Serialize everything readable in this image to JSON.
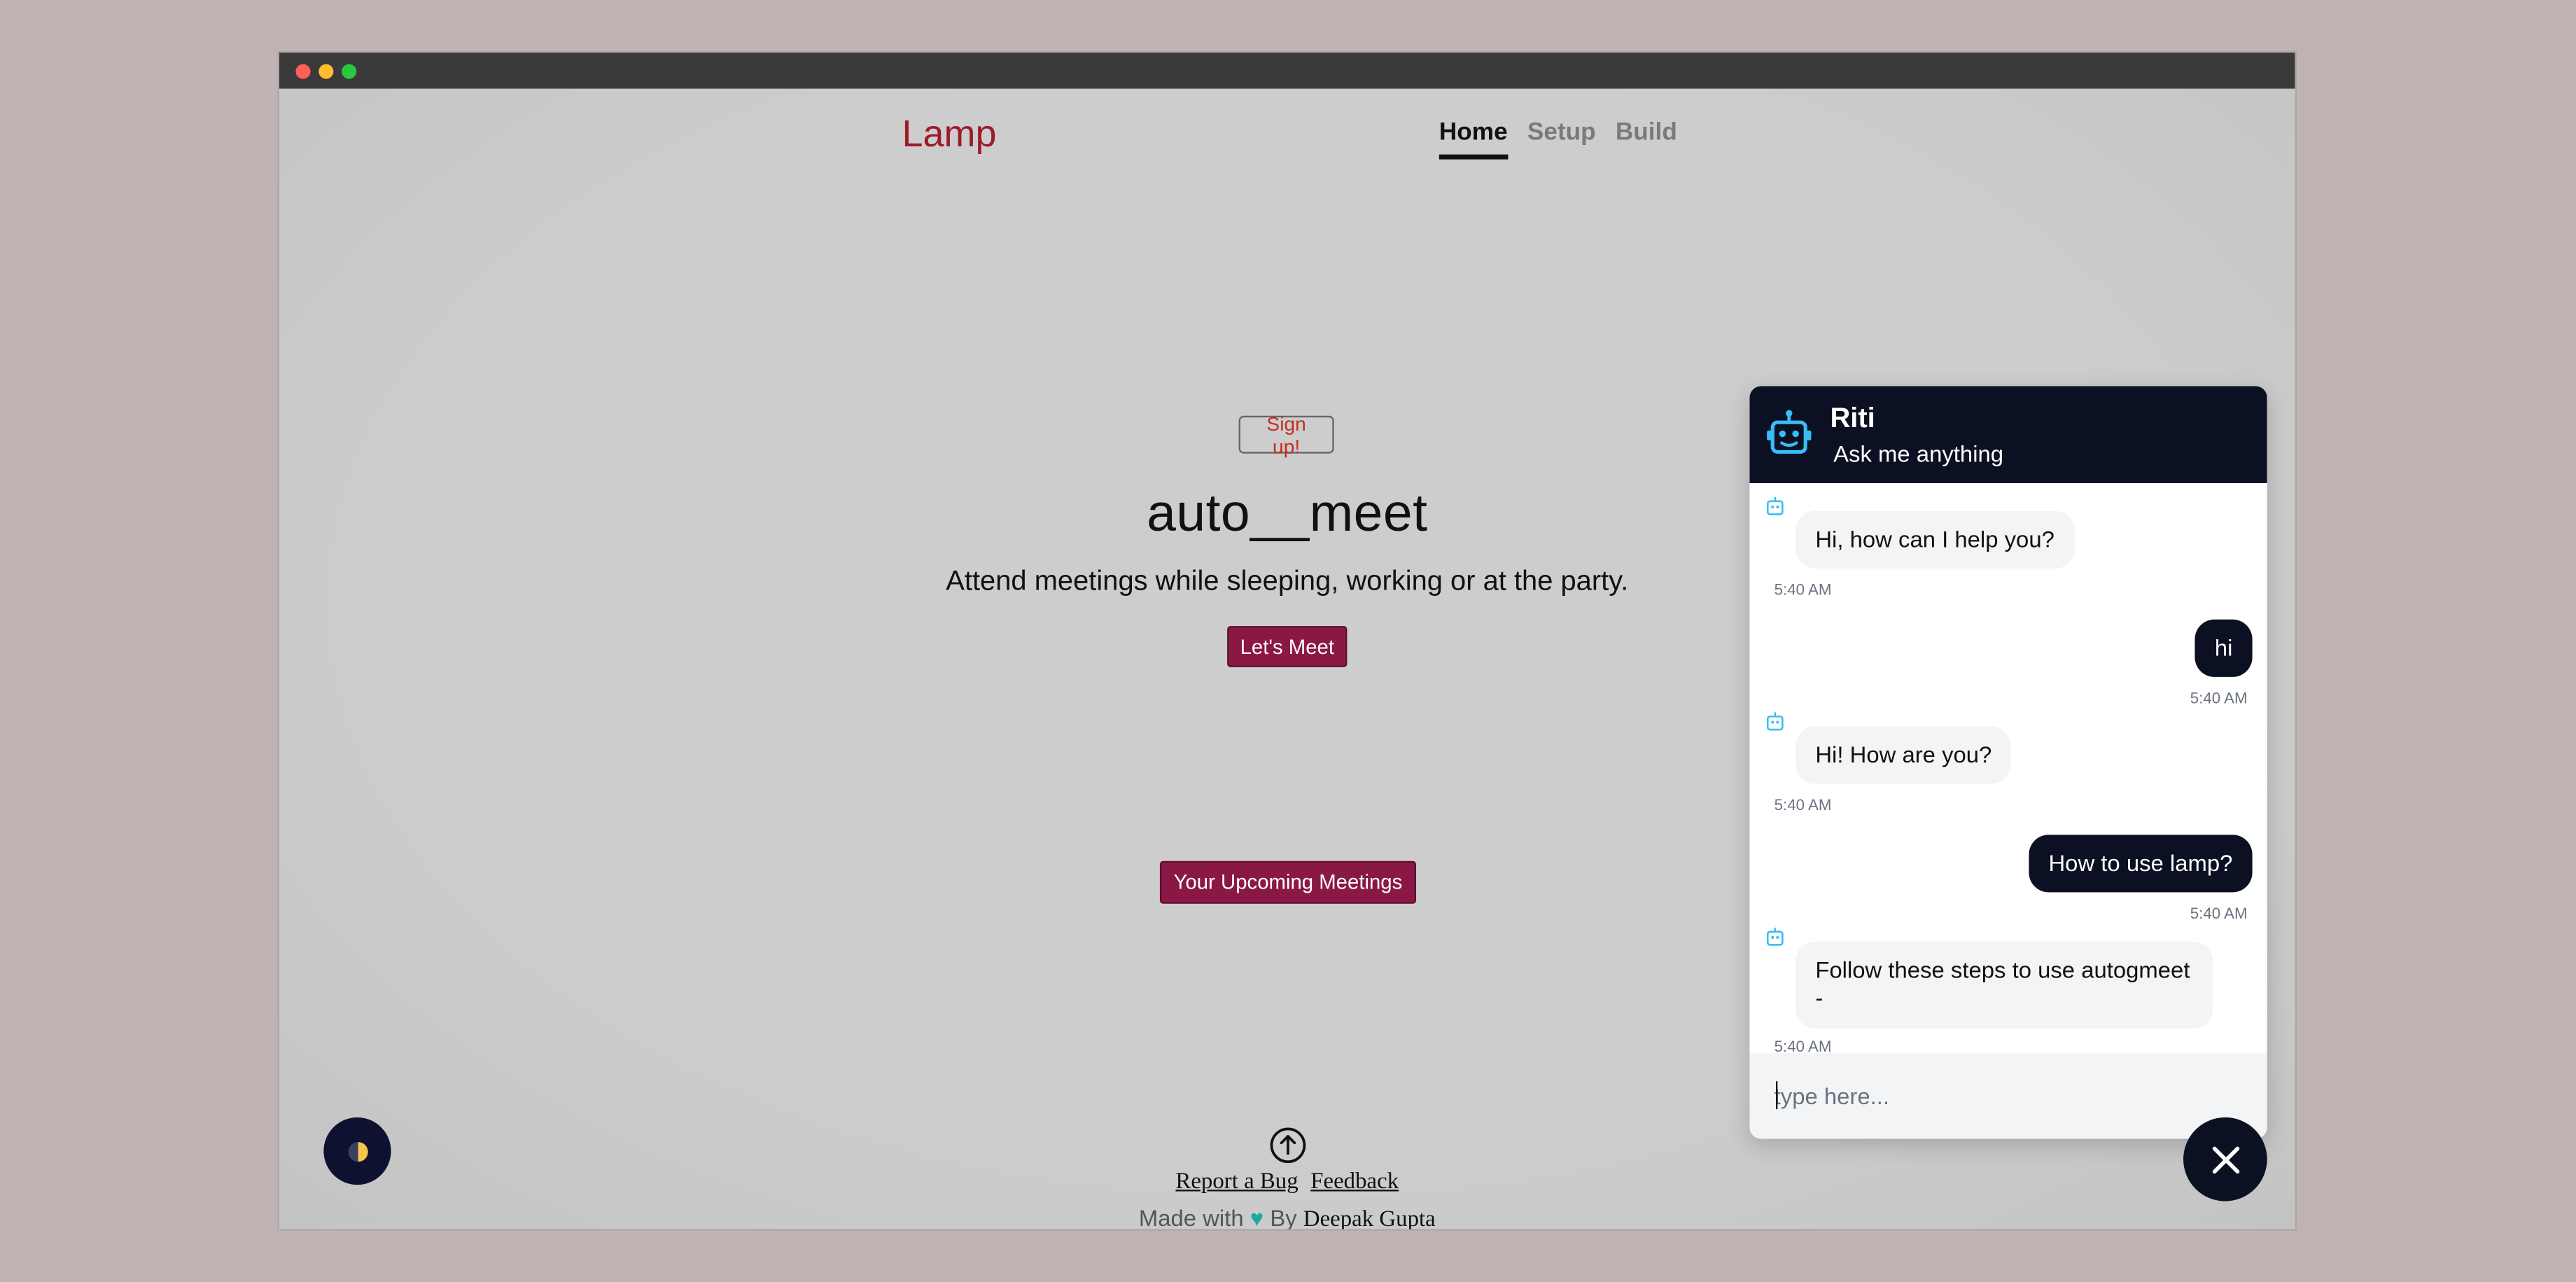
{
  "window": {
    "controls": [
      "close",
      "minimize",
      "maximize"
    ]
  },
  "brand": {
    "name": "Lamp",
    "color": "#9b1b2a"
  },
  "nav": {
    "items": [
      {
        "label": "Home",
        "active": true
      },
      {
        "label": "Setup",
        "active": false
      },
      {
        "label": "Build",
        "active": false
      }
    ]
  },
  "hero": {
    "signup_label": "Sign up!",
    "title": "auto__meet",
    "subtitle": "Attend meetings while sleeping, working or at the party.",
    "cta_label": "Let's Meet"
  },
  "upcoming_label": "Your Upcoming Meetings",
  "footer": {
    "icon": "upload-circle-icon",
    "report_bug": "Report a Bug",
    "feedback": "Feedback",
    "made_with": "Made with",
    "heart": "♥",
    "by": "By",
    "author": "Deepak Gupta"
  },
  "theme_toggle": {
    "icon": "half-moon-icon"
  },
  "chat": {
    "name": "Riti",
    "tagline": "Ask me anything",
    "messages": [
      {
        "from": "bot",
        "text": "Hi, how can I help you?",
        "time": "5:40 AM"
      },
      {
        "from": "user",
        "text": "hi",
        "time": "5:40 AM"
      },
      {
        "from": "bot",
        "text": "Hi! How are you?",
        "time": "5:40 AM"
      },
      {
        "from": "user",
        "text": "How to use lamp?",
        "time": "5:40 AM"
      },
      {
        "from": "bot",
        "text": "Follow these steps to use autogmeet -",
        "time": "5:40 AM"
      }
    ],
    "input_placeholder": "type here...",
    "close_icon": "close-icon"
  },
  "colors": {
    "accent_maroon": "#8a1845",
    "chat_dark": "#0b1122",
    "bot_icon": "#38bdf8",
    "heart": "#1ea8a2"
  }
}
